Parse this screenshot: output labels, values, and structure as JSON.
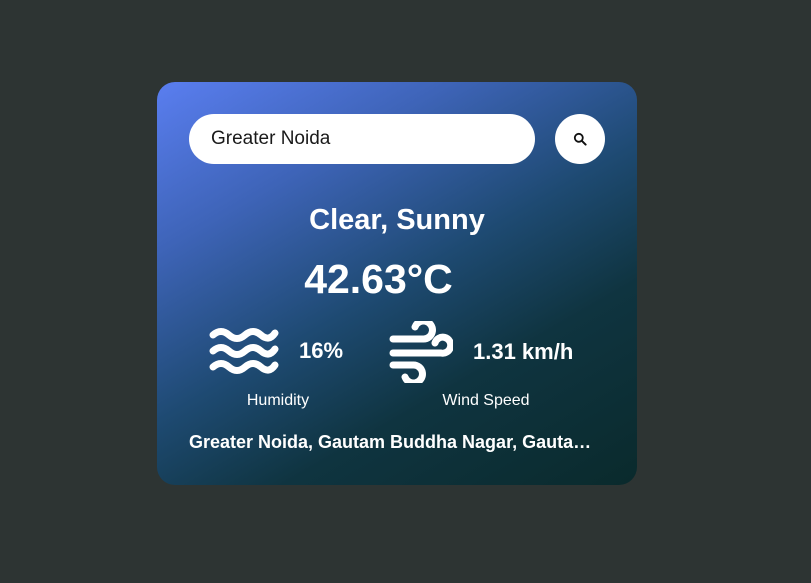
{
  "search": {
    "value": "Greater Noida",
    "button_icon": "search-icon"
  },
  "weather": {
    "condition": "Clear, Sunny",
    "temperature": "42.63°C"
  },
  "humidity": {
    "icon": "waves-icon",
    "value": "16%",
    "label": "Humidity"
  },
  "wind": {
    "icon": "wind-icon",
    "value": "1.31 km/h",
    "label": "Wind Speed"
  },
  "location": {
    "full_name": "Greater Noida, Gautam Buddha Nagar, Gautam Buddha Nagar, Uttar Pradesh, India"
  },
  "colors": {
    "background": "#2d3433",
    "card_gradient_start": "#5a7ef0",
    "card_gradient_end": "#0a2a2c",
    "text": "#ffffff"
  }
}
